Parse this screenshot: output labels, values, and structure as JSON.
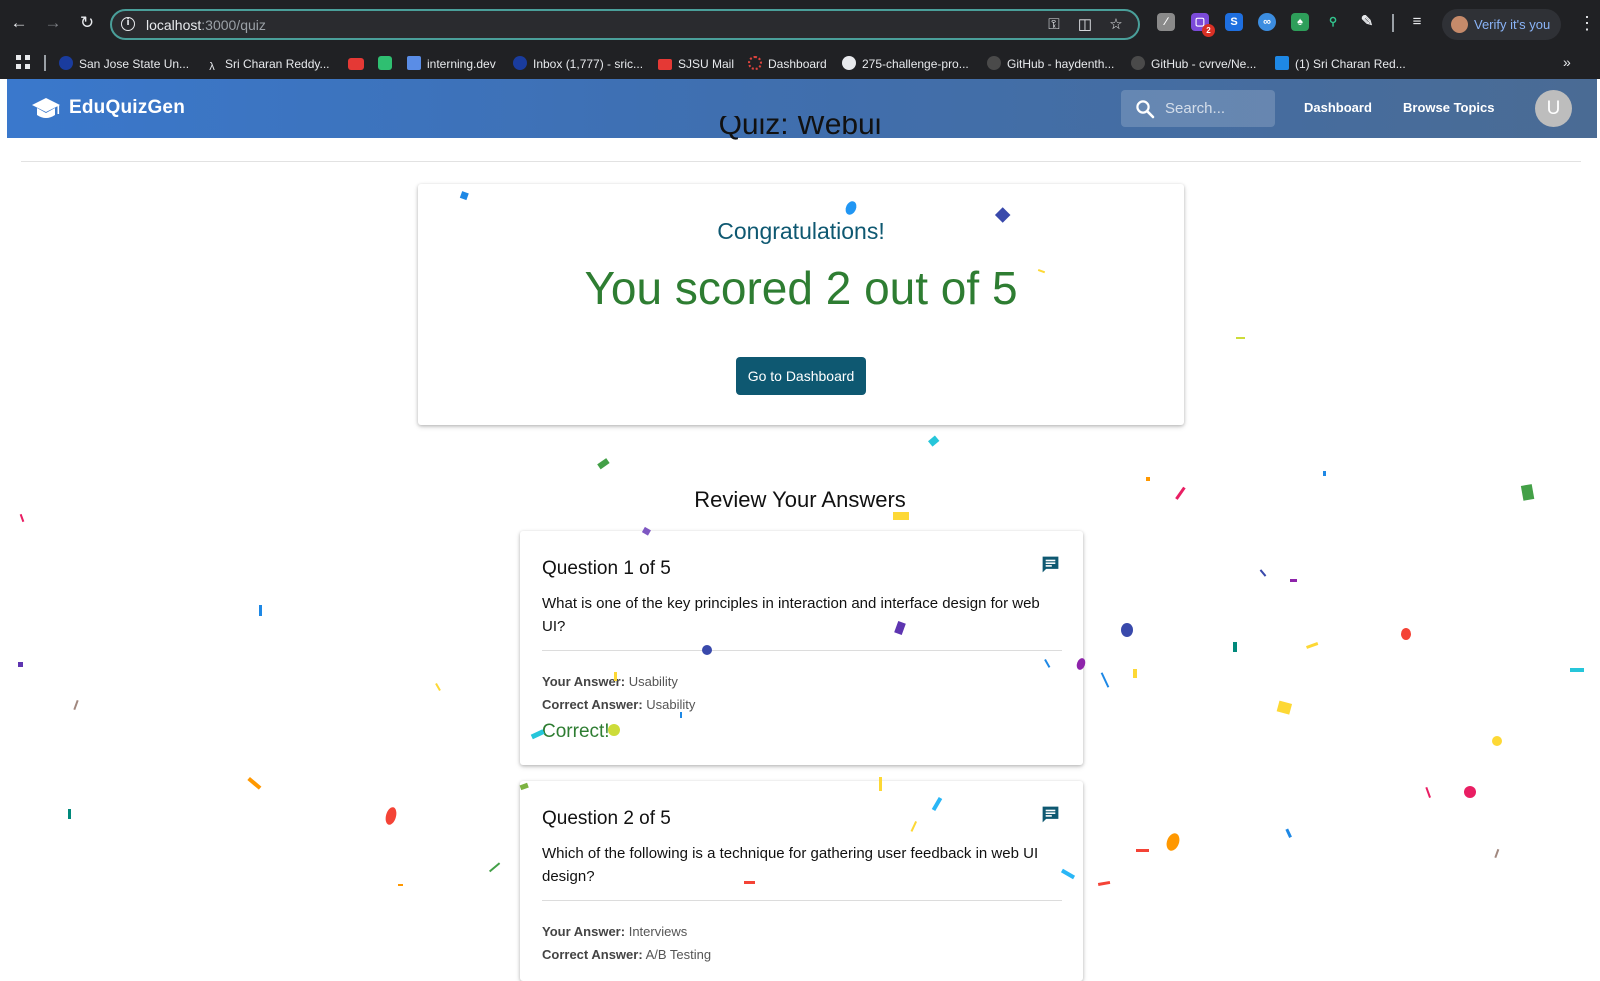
{
  "browser": {
    "url_host": "localhost",
    "url_path": ":3000/quiz",
    "verify_label": "Verify it's you",
    "extension_badge": "2",
    "bookmarks": [
      {
        "label": "San Jose State Un...",
        "color": "#1a3c9e"
      },
      {
        "label": "Sri Charan Reddy...",
        "color": "#202124"
      },
      {
        "label": "",
        "color": "#e53935"
      },
      {
        "label": "",
        "color": "#2fbf71"
      },
      {
        "label": "interning.dev",
        "color": "#5a8de6"
      },
      {
        "label": "Inbox (1,777) - sric...",
        "color": "#1a3c9e"
      },
      {
        "label": "SJSU Mail",
        "color": "#e53935"
      },
      {
        "label": "Dashboard",
        "color": "#e0443e"
      },
      {
        "label": "275-challenge-pro...",
        "color": "#e8eaed"
      },
      {
        "label": "GitHub - haydenth...",
        "color": "#4a4a4a"
      },
      {
        "label": "GitHub - cvrve/Ne...",
        "color": "#4a4a4a"
      },
      {
        "label": "(1) Sri Charan Red...",
        "color": "#1e88e5"
      }
    ]
  },
  "app": {
    "brand": "EduQuizGen",
    "search_placeholder": "Search...",
    "nav": {
      "dashboard": "Dashboard",
      "browse": "Browse Topics"
    },
    "avatar_initial": "U"
  },
  "page": {
    "cut_title": "Quiz: Webui",
    "congrats": "Congratulations!",
    "score_text": "You scored 2 out of 5",
    "dashboard_button": "Go to Dashboard",
    "review_heading": "Review Your Answers"
  },
  "questions": [
    {
      "title": "Question 1 of 5",
      "text": "What is one of the key principles in interaction and interface design for web UI?",
      "your_label": "Your Answer:",
      "your_answer": "Usability",
      "correct_label": "Correct Answer:",
      "correct_answer": "Usability",
      "result": "Correct!"
    },
    {
      "title": "Question 2 of 5",
      "text": "Which of the following is a technique for gathering user feedback in web UI design?",
      "your_label": "Your Answer:",
      "your_answer": "Interviews",
      "correct_label": "Correct Answer:",
      "correct_answer": "A/B Testing"
    }
  ],
  "colors": {
    "header_start": "#3a78cc",
    "header_end": "#4a6b94",
    "accent_teal": "#0e5871",
    "success_green": "#2e7d32"
  },
  "icons": {
    "brand": "graduation-cap-icon",
    "search": "search-icon",
    "comment": "comment-icon"
  }
}
